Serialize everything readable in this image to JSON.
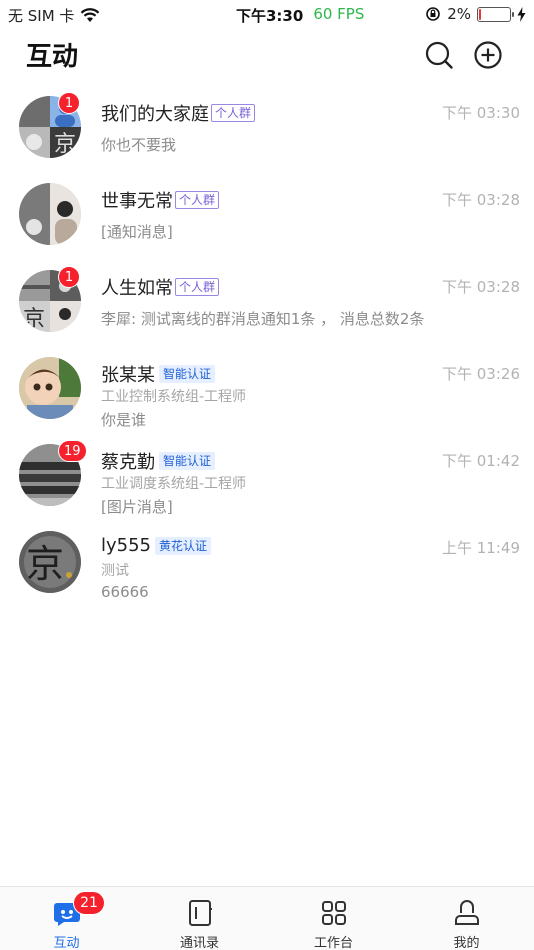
{
  "status_bar": {
    "carrier": "无 SIM 卡",
    "time": "下午3:30",
    "fps": "60 FPS",
    "battery": "2%",
    "battery_level": 0.05
  },
  "header": {
    "title": "互动",
    "search_icon": "search-icon",
    "add_icon": "plus-circle-icon"
  },
  "conversations": [
    {
      "name": "我们的大家庭",
      "tag": "个人群",
      "time": "下午 03:30",
      "dept": "",
      "message": "你也不要我",
      "badge": "1"
    },
    {
      "name": "世事无常",
      "tag": "个人群",
      "time": "下午 03:28",
      "dept": "",
      "message": "[通知消息]",
      "badge": ""
    },
    {
      "name": "人生如常",
      "tag": "个人群",
      "time": "下午 03:28",
      "dept": "",
      "message": "李犀: 测试离线的群消息通知1条 ， 消息总数2条",
      "badge": "1"
    },
    {
      "name": "张某某",
      "tag": "智能认证",
      "time": "下午 03:26",
      "dept": "工业控制系统组-工程师",
      "message": "你是谁",
      "badge": ""
    },
    {
      "name": "蔡克勤",
      "tag": "智能认证",
      "time": "下午 01:42",
      "dept": "工业调度系统组-工程师",
      "message": "[图片消息]",
      "badge": "19"
    },
    {
      "name": "ly555",
      "tag": "黄花认证",
      "time": "上午 11:49",
      "dept": "测试",
      "message": "66666",
      "badge": ""
    }
  ],
  "tabs": [
    {
      "label": "互动",
      "icon": "chat-icon",
      "badge": "21",
      "active": true
    },
    {
      "label": "通讯录",
      "icon": "contacts-icon",
      "badge": "",
      "active": false
    },
    {
      "label": "工作台",
      "icon": "grid-icon",
      "badge": "",
      "active": false
    },
    {
      "label": "我的",
      "icon": "user-icon",
      "badge": "",
      "active": false
    }
  ],
  "colors": {
    "accent": "#1f6fe8",
    "badge": "#f5222d",
    "fps": "#2db84d",
    "group_tag": "#7b61d6",
    "auth_tag": "#1f5fd6"
  }
}
